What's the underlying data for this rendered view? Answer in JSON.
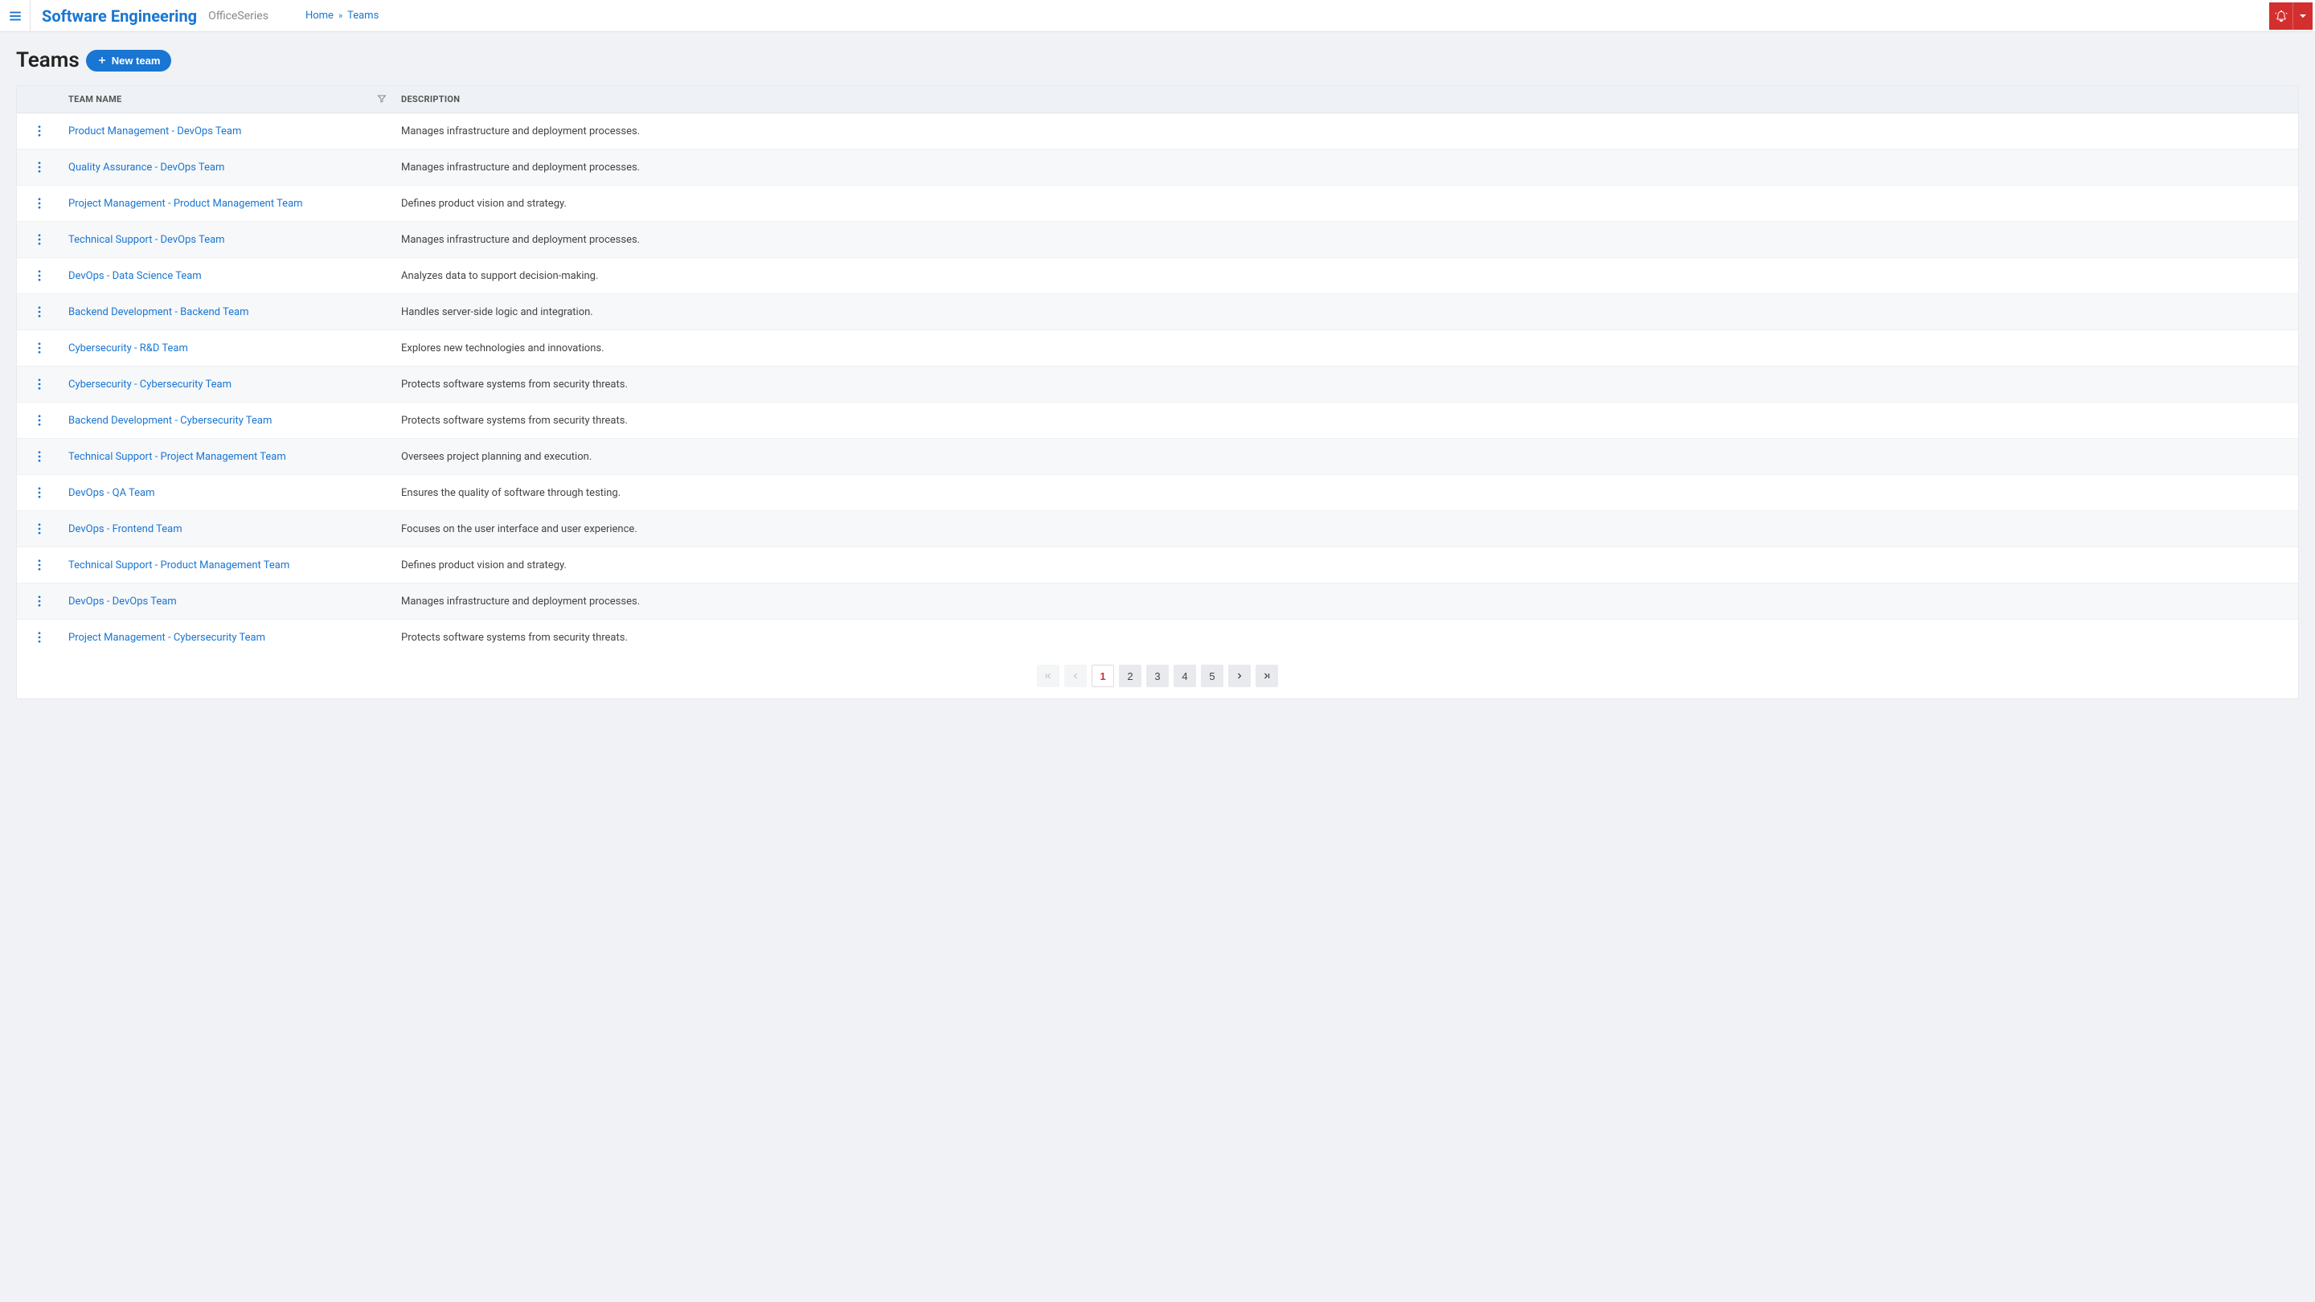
{
  "header": {
    "app_title": "Software Engineering",
    "app_subtitle": "OfficeSeries",
    "breadcrumb": {
      "home": "Home",
      "sep": "»",
      "current": "Teams"
    }
  },
  "page": {
    "title": "Teams",
    "new_button": "New team"
  },
  "table": {
    "columns": {
      "name": "TEAM NAME",
      "description": "DESCRIPTION"
    },
    "rows": [
      {
        "name": "Product Management - DevOps Team",
        "description": "Manages infrastructure and deployment processes."
      },
      {
        "name": "Quality Assurance - DevOps Team",
        "description": "Manages infrastructure and deployment processes."
      },
      {
        "name": "Project Management - Product Management Team",
        "description": "Defines product vision and strategy."
      },
      {
        "name": "Technical Support - DevOps Team",
        "description": "Manages infrastructure and deployment processes."
      },
      {
        "name": "DevOps - Data Science Team",
        "description": "Analyzes data to support decision-making."
      },
      {
        "name": "Backend Development - Backend Team",
        "description": "Handles server-side logic and integration."
      },
      {
        "name": "Cybersecurity - R&D Team",
        "description": "Explores new technologies and innovations."
      },
      {
        "name": "Cybersecurity - Cybersecurity Team",
        "description": "Protects software systems from security threats."
      },
      {
        "name": "Backend Development - Cybersecurity Team",
        "description": "Protects software systems from security threats."
      },
      {
        "name": "Technical Support - Project Management Team",
        "description": "Oversees project planning and execution."
      },
      {
        "name": "DevOps - QA Team",
        "description": "Ensures the quality of software through testing."
      },
      {
        "name": "DevOps - Frontend Team",
        "description": "Focuses on the user interface and user experience."
      },
      {
        "name": "Technical Support - Product Management Team",
        "description": "Defines product vision and strategy."
      },
      {
        "name": "DevOps - DevOps Team",
        "description": "Manages infrastructure and deployment processes."
      },
      {
        "name": "Project Management - Cybersecurity Team",
        "description": "Protects software systems from security threats."
      }
    ]
  },
  "pagination": {
    "pages": [
      "1",
      "2",
      "3",
      "4",
      "5"
    ],
    "current": "1"
  }
}
